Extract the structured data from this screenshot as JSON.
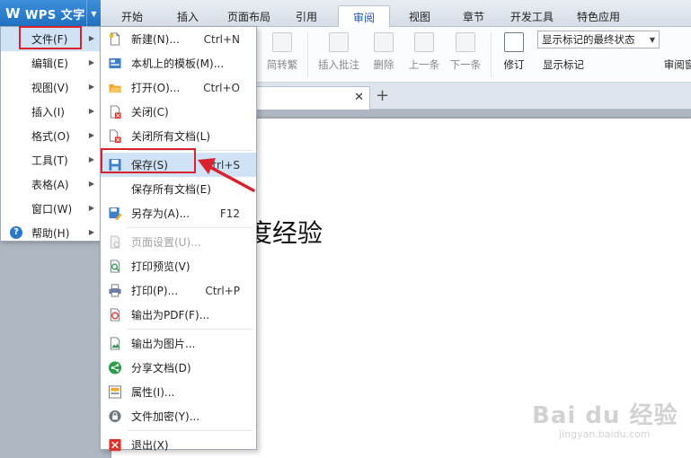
{
  "app": {
    "name": "WPS 文字",
    "logo": "W"
  },
  "tabs": [
    {
      "label": "开始"
    },
    {
      "label": "插入"
    },
    {
      "label": "页面布局"
    },
    {
      "label": "引用"
    },
    {
      "label": "审阅",
      "active": true
    },
    {
      "label": "视图"
    },
    {
      "label": "章节"
    },
    {
      "label": "开发工具"
    },
    {
      "label": "特色应用"
    }
  ],
  "ribbon": {
    "jianzhuanfan": "简转繁",
    "insert_comment": "插入批注",
    "delete": "删除",
    "prev": "上一条",
    "next": "下一条",
    "revision": "修订",
    "show_markup": "显示标记",
    "display_select": "显示标记的最终状态",
    "review_pane": "审阅窗"
  },
  "doc": {
    "body_text": "度经验"
  },
  "main_menu": [
    {
      "label": "文件(F)",
      "selected": true
    },
    {
      "label": "编辑(E)"
    },
    {
      "label": "视图(V)"
    },
    {
      "label": "插入(I)"
    },
    {
      "label": "格式(O)"
    },
    {
      "label": "工具(T)"
    },
    {
      "label": "表格(A)"
    },
    {
      "label": "窗口(W)"
    },
    {
      "label": "帮助(H)"
    }
  ],
  "file_menu": [
    {
      "label": "新建(N)...",
      "shortcut": "Ctrl+N",
      "icon": "new-doc-icon"
    },
    {
      "label": "本机上的模板(M)...",
      "shortcut": "",
      "icon": "template-icon"
    },
    {
      "label": "打开(O)...",
      "shortcut": "Ctrl+O",
      "icon": "open-folder-icon"
    },
    {
      "label": "关闭(C)",
      "shortcut": "",
      "icon": "close-doc-icon"
    },
    {
      "label": "关闭所有文档(L)",
      "shortcut": "",
      "icon": "close-all-icon"
    },
    {
      "label": "保存(S)",
      "shortcut": "Ctrl+S",
      "icon": "save-icon",
      "selected": true
    },
    {
      "label": "保存所有文档(E)",
      "shortcut": "",
      "icon": ""
    },
    {
      "label": "另存为(A)...",
      "shortcut": "F12",
      "icon": "save-as-icon"
    },
    {
      "label": "页面设置(U)...",
      "shortcut": "",
      "icon": "page-setup-icon",
      "disabled": true
    },
    {
      "label": "打印预览(V)",
      "shortcut": "",
      "icon": "print-preview-icon"
    },
    {
      "label": "打印(P)...",
      "shortcut": "Ctrl+P",
      "icon": "printer-icon"
    },
    {
      "label": "输出为PDF(F)...",
      "shortcut": "",
      "icon": "pdf-icon"
    },
    {
      "label": "输出为图片...",
      "shortcut": "",
      "icon": "export-image-icon"
    },
    {
      "label": "分享文档(D)",
      "shortcut": "",
      "icon": "share-icon"
    },
    {
      "label": "属性(I)...",
      "shortcut": "",
      "icon": "properties-icon"
    },
    {
      "label": "文件加密(Y)...",
      "shortcut": "",
      "icon": "encrypt-icon"
    },
    {
      "label": "退出(X)",
      "shortcut": "",
      "icon": "exit-icon"
    }
  ],
  "watermark": {
    "brand": "Bai du 经验",
    "url": "jingyan.baidu.com"
  },
  "colors": {
    "accent": "#2b78c9",
    "highlight": "#cfe2f6",
    "annotation": "#d8222e"
  }
}
